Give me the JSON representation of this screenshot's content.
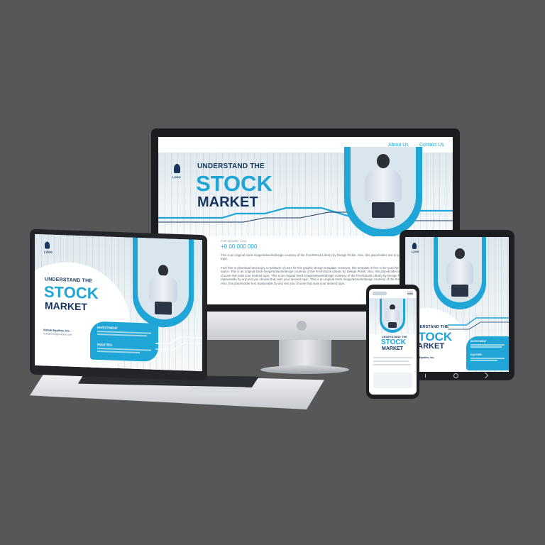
{
  "monitor": {
    "nav": {
      "about": "About Us",
      "contact": "Contact Us"
    },
    "headline": {
      "line1": "UNDERSTAND THE",
      "line2": "STOCK",
      "line3": "MARKET"
    },
    "logo": "LOGO",
    "call_label": "FOR INQUIRY CALL",
    "phone": "+0 00 000 000",
    "para1": "This is an original stock image/artwork/design courtesy of the FreshStock Library by Design Pickle. Also, this placeholder text is you choose that suits your desired topic.",
    "para2": "Feel free to download and enjoy a multitude of uses for this graphic design template. However, this template is free to be used for promotions and for different topics. This is an original stock image/artwork/design courtesy of the FreshStock Library by Design Pickle. Also, this placeholder text replaceable by any text you choose that suits your desired topic. This is an original stock image/artwork/design courtesy of the FreshStock Library by Design Pickle. Also, this placeholder text replaceable by any text you choose that suits your desired topic. This is an original stock image/artwork/design courtesy of the FreshStock Library by Design Pickle. Also, this placeholder text replaceable by any text you choose that suits your desired topic."
  },
  "laptop": {
    "logo": "LOGO",
    "headline": {
      "line1": "UNDERSTAND THE",
      "line2": "STOCK",
      "line3": "MARKET"
    },
    "section1": "INVESTMENT",
    "section2": "EQUITIES",
    "company": "Ashok Equities, Inc.",
    "email": "hello@reallygreatsite.com"
  },
  "tablet": {
    "logo": "LOGO",
    "headline": {
      "line1": "UNDERSTAND THE",
      "line2": "STOCK",
      "line3": "MARKET"
    },
    "section1": "INVESTMENT",
    "section2": "EQUITIES",
    "company": "Ashok Equities, Inc."
  },
  "phone": {
    "headline": {
      "line1": "UNDERSTAND THE",
      "line2": "STOCK",
      "line3": "MARKET"
    }
  },
  "colors": {
    "background": "#575757",
    "accent": "#1fa5d6",
    "navy": "#15355f"
  }
}
